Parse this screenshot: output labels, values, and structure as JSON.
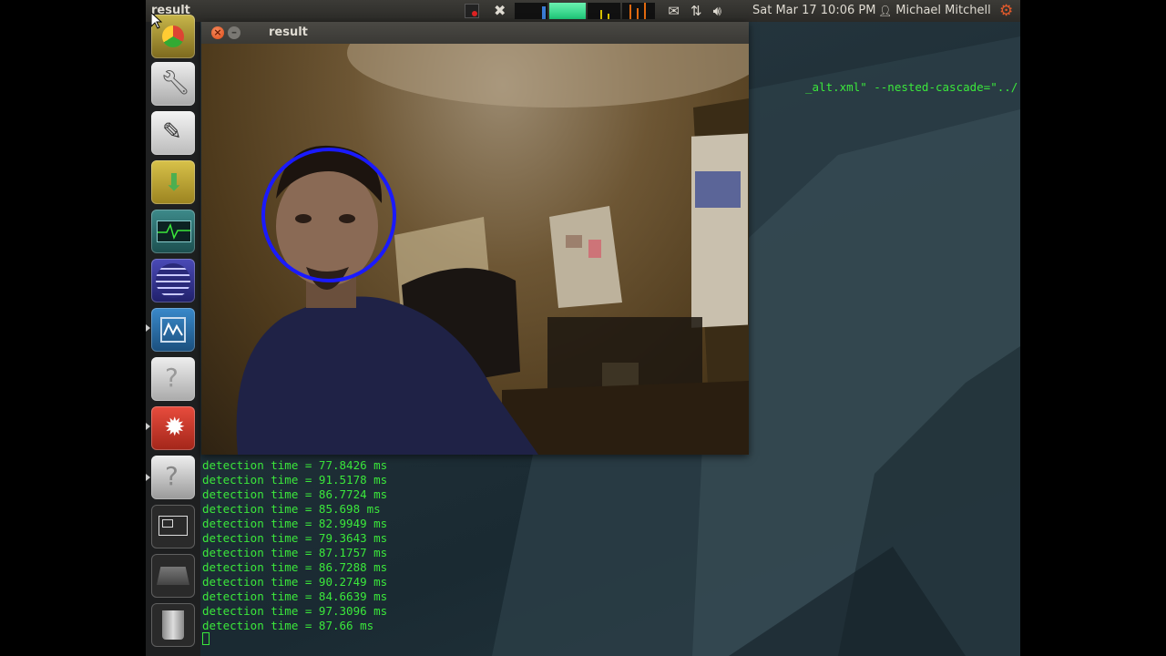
{
  "topbar": {
    "app_title": "result",
    "clock": "Sat Mar 17 10:06 PM",
    "user_name": "Michael Mitchell"
  },
  "window": {
    "title": "result",
    "close_glyph": "×",
    "minimize_glyph": "–"
  },
  "terminal": {
    "command_tail": "_alt.xml\" --nested-cascade=\"../../d",
    "lines": [
      "detection time = 77.8426 ms",
      "detection time = 91.5178 ms",
      "detection time = 86.7724 ms",
      "detection time = 85.698 ms",
      "detection time = 82.9949 ms",
      "detection time = 79.3643 ms",
      "detection time = 87.1757 ms",
      "detection time = 86.7288 ms",
      "detection time = 90.2749 ms",
      "detection time = 84.6639 ms",
      "detection time = 97.3096 ms",
      "detection time = 87.66 ms"
    ]
  },
  "launcher": {
    "items": [
      {
        "icon": "chromium-icon"
      },
      {
        "icon": "system-settings-icon"
      },
      {
        "icon": "text-editor-icon"
      },
      {
        "icon": "archive-manager-icon"
      },
      {
        "icon": "system-monitor-icon"
      },
      {
        "icon": "eclipse-icon"
      },
      {
        "icon": "system-monitor-alt-icon"
      },
      {
        "icon": "unknown-app-icon"
      },
      {
        "icon": "update-alert-icon"
      },
      {
        "icon": "unknown-app-2-icon"
      },
      {
        "icon": "workspace-switcher-icon"
      },
      {
        "icon": "removable-drive-icon"
      },
      {
        "icon": "trash-icon"
      }
    ]
  },
  "colors": {
    "terminal_text": "#3be83b",
    "face_circle": "#1a1aff",
    "panel": "#3c3b37"
  }
}
